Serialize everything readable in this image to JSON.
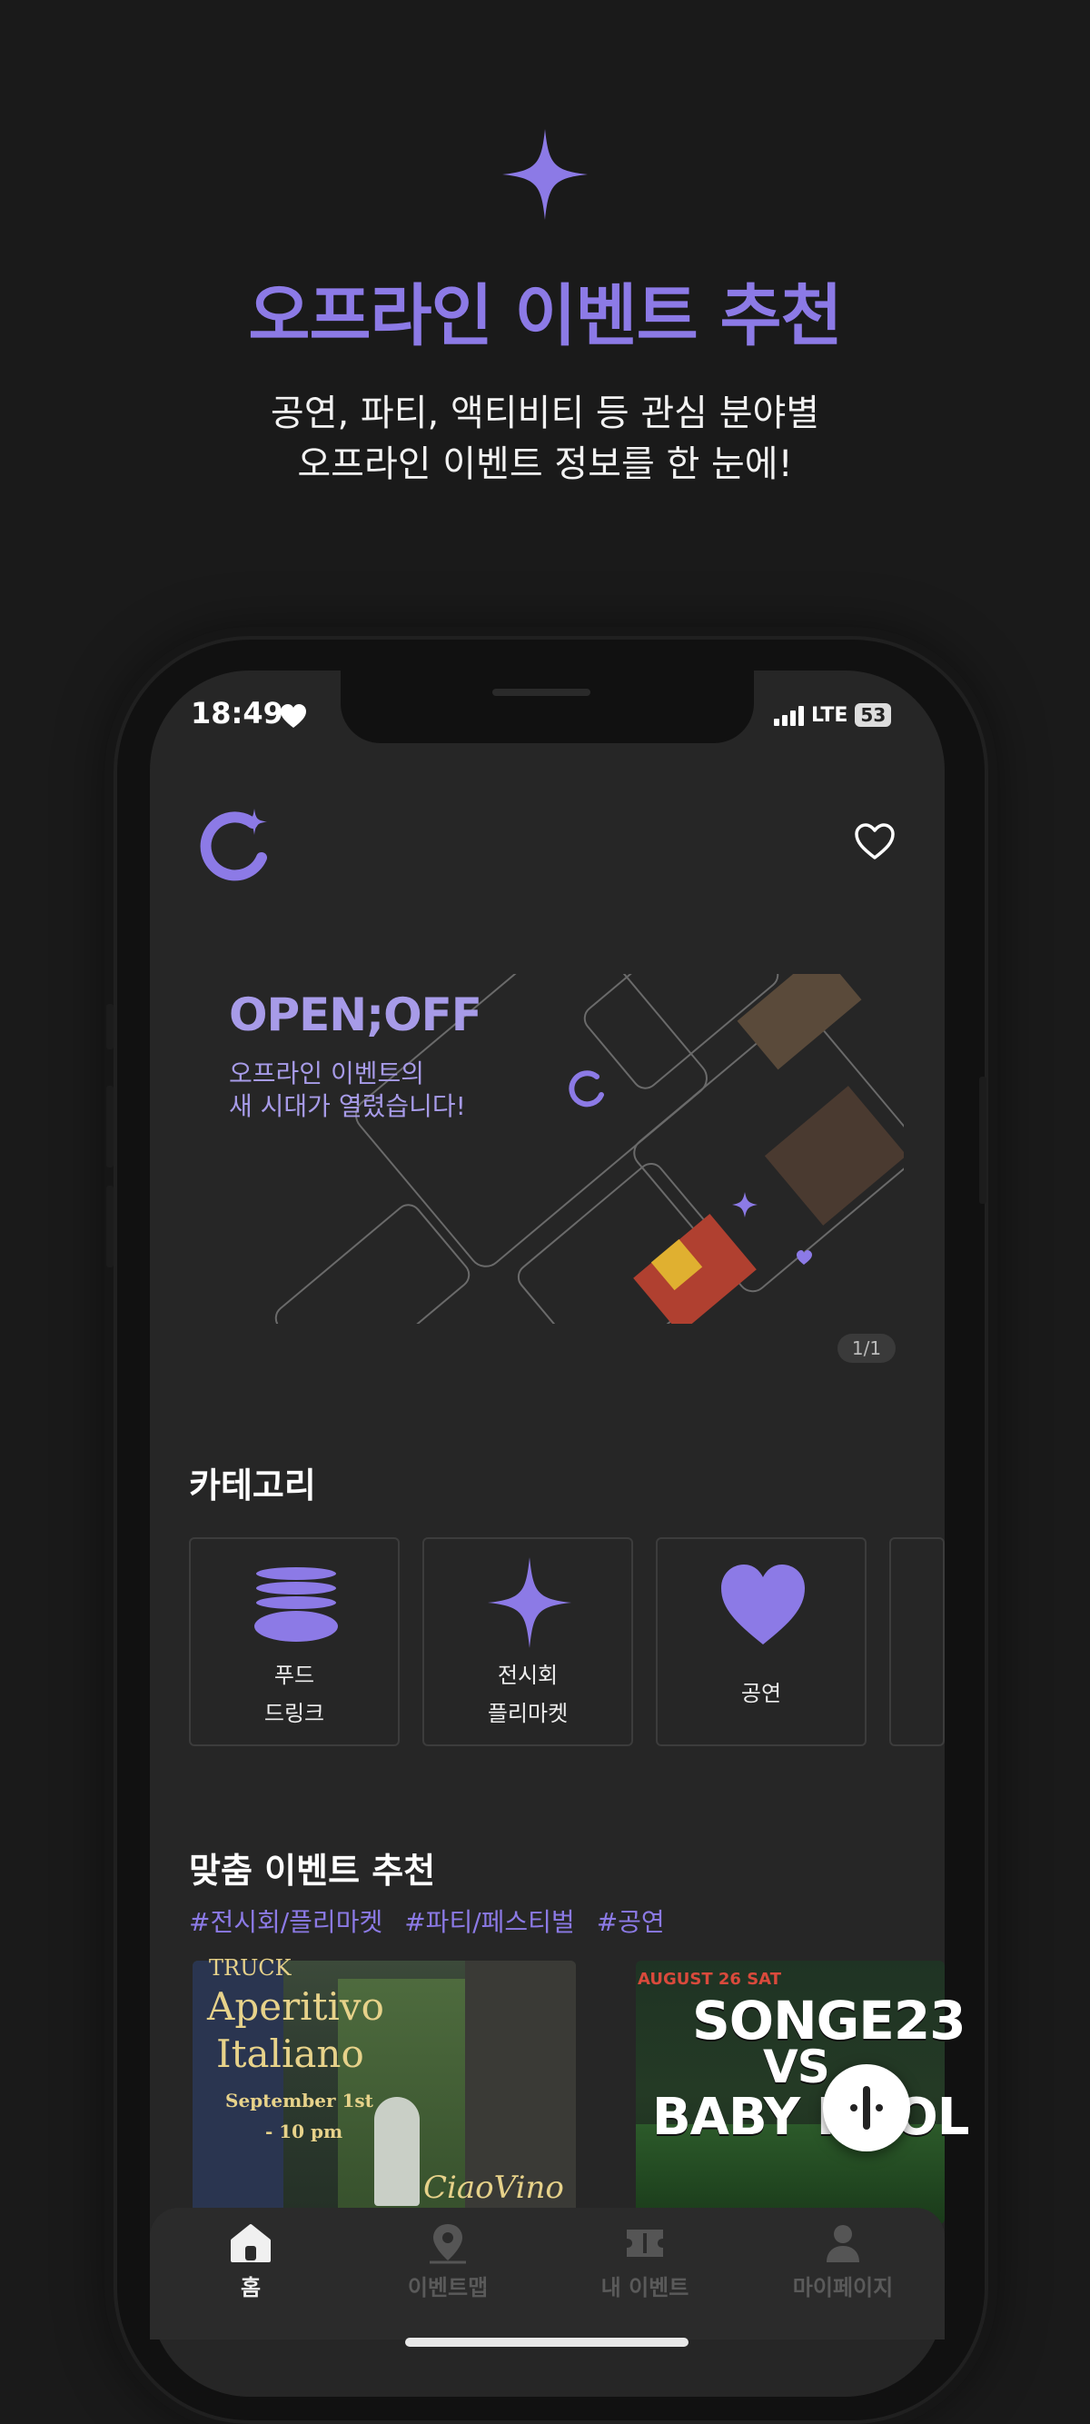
{
  "promo": {
    "headline": "오프라인 이벤트 추천",
    "subline_1": "공연, 파티, 액티비티 등 관심 분야별",
    "subline_2": "오프라인 이벤트 정보를 한 눈에!"
  },
  "status_bar": {
    "time": "18:49",
    "network": "LTE",
    "battery": "53"
  },
  "header": {
    "logo_icon": "app-logo-icon",
    "favorites_icon": "heart-outline-icon"
  },
  "banner": {
    "title": "OPEN;OFF",
    "subtitle_1": "오프라인 이벤트의",
    "subtitle_2": "새 시대가 열렸습니다!",
    "pager": "1/1"
  },
  "categories": {
    "title": "카테고리",
    "items": [
      {
        "label_1": "푸드",
        "label_2": "드링크",
        "icon": "food-stack-icon"
      },
      {
        "label_1": "전시회",
        "label_2": "플리마켓",
        "icon": "sparkle-icon"
      },
      {
        "label_1": "공연",
        "label_2": "",
        "icon": "heart-icon"
      }
    ]
  },
  "recommend": {
    "title": "맞춤 이벤트 추천",
    "tags": [
      "#전시회/플리마켓",
      "#파티/페스티벌",
      "#공연"
    ],
    "events": [
      {
        "line_1": "Aperitivo",
        "line_2": "Italiano",
        "line_3": "September 1st",
        "line_4": "- 10 pm",
        "brand": "CiaoVino",
        "top": "TRUCK"
      },
      {
        "top": "AUGUST 26 SAT",
        "line_1": "SONGE23",
        "line_2": "VS",
        "line_3": "BABY KOOL"
      }
    ]
  },
  "tabs": [
    {
      "label": "홈",
      "icon": "home-icon",
      "active": true
    },
    {
      "label": "이벤트맵",
      "icon": "map-pin-icon",
      "active": false
    },
    {
      "label": "내 이벤트",
      "icon": "ticket-icon",
      "active": false
    },
    {
      "label": "마이페이지",
      "icon": "person-icon",
      "active": false
    }
  ],
  "colors": {
    "accent": "#8c7ae6",
    "background": "#1a1a1a",
    "screen": "#262626"
  }
}
